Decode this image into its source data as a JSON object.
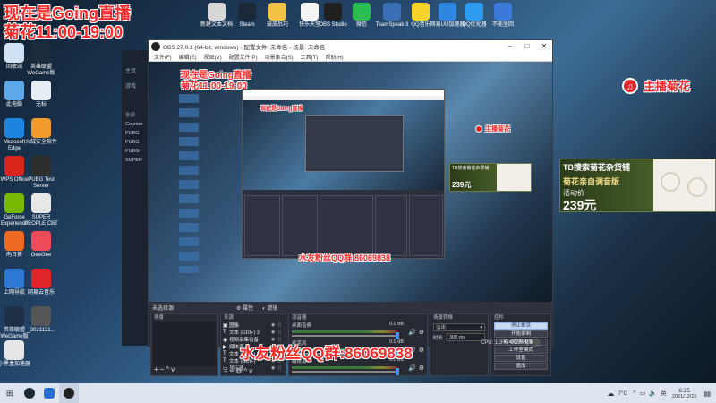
{
  "overlay": {
    "title_line1": "现在是Going直播",
    "title_line2": "菊花11:00-19:00",
    "host_label": "主播菊花",
    "fan_group": "水友粉丝QQ群:86069838"
  },
  "banner": {
    "line1": "TB搜索菊花杂货铺",
    "line2": "菊花亲自调音版",
    "line3": "活动价",
    "price": "239元"
  },
  "top_icons": [
    {
      "label": "新建文本文档",
      "color": "#d7d7d7"
    },
    {
      "label": "Steam",
      "color": "#1b2838"
    },
    {
      "label": "鼓皮后巧",
      "color": "#f2c244"
    },
    {
      "label": "快乐天堂",
      "color": "#f5f5f5"
    },
    {
      "label": "OBS Studio",
      "color": "#202020"
    },
    {
      "label": "微信",
      "color": "#2bbd52"
    },
    {
      "label": "TeamSpeak 3",
      "color": "#3a6fb5"
    },
    {
      "label": "QQ音乐",
      "color": "#f7d42c"
    },
    {
      "label": "网易UU加速器",
      "color": "#2f86e0"
    },
    {
      "label": "QQ优化器",
      "color": "#2d9cf0"
    },
    {
      "label": "不能坐回",
      "color": "#3b7ad8"
    }
  ],
  "desktop_icons": [
    {
      "label": "回收站",
      "color": "#cfe1f2"
    },
    {
      "label": "英雄联盟WeGame版",
      "color": "#1d2a3a"
    },
    {
      "label": "此电脑",
      "color": "#5da8e8"
    },
    {
      "label": "无标",
      "color": "#e8eef5"
    },
    {
      "label": "Microsoft Edge",
      "color": "#1d85e0"
    },
    {
      "label": "火绒安全软件",
      "color": "#f29a2e"
    },
    {
      "label": "WPS Office",
      "color": "#d8261c"
    },
    {
      "label": "PUBG Test Server",
      "color": "#2e2e2e"
    },
    {
      "label": "GeForce Experience",
      "color": "#76b900"
    },
    {
      "label": "SUPER PEOPLE CBT",
      "color": "#e8e8e8"
    },
    {
      "label": "向日葵",
      "color": "#ee6a21"
    },
    {
      "label": "GeeGee",
      "color": "#ee4b58"
    },
    {
      "label": "上网导航",
      "color": "#2d78d2"
    },
    {
      "label": "网易云音乐",
      "color": "#e1262a"
    },
    {
      "label": "英雄联盟WeGame版",
      "color": "#1f2f45"
    },
    {
      "label": "_2021121...",
      "color": "#555"
    },
    {
      "label": "小黑盒加速器",
      "color": "#e6e6e6"
    }
  ],
  "obs": {
    "title": "OBS 27.0.1 (64-bit, windows) - 配置文件: 未命名 - 场景: 未命名",
    "menu": [
      "文件(F)",
      "编辑(E)",
      "视图(V)",
      "配置文件(P)",
      "场景集合(S)",
      "工具(T)",
      "帮助(H)"
    ],
    "scenes_title": "场景",
    "scenes_header": "未选择源",
    "props_label": "属性",
    "filters_label": "滤镜",
    "sources_title": "来源",
    "sources": [
      {
        "name": "图像"
      },
      {
        "name": "文本 (GDI+) 3"
      },
      {
        "name": "视频采集设备"
      },
      {
        "name": "媒体源"
      },
      {
        "name": "文本 (GDI+) 2"
      },
      {
        "name": "文本 (GDI+)"
      },
      {
        "name": "显示器"
      }
    ],
    "mixer_title": "混音器",
    "mixer": [
      {
        "name": "桌面音频",
        "db": "0.0 dB"
      },
      {
        "name": "麦克风",
        "db": "0.0 dB"
      },
      {
        "name": "媒体源",
        "db": "0.0 dB"
      }
    ],
    "transitions_title": "场景转换",
    "transition_value": "淡出",
    "duration_label": "时长",
    "duration_value": "300 ms",
    "controls_title": "控件",
    "controls": [
      "停止推流",
      "开始录制",
      "启动虚拟摄像机",
      "工作室模式",
      "设置",
      "退出"
    ],
    "status": "CPU: 1.3%, 60.00 fps"
  },
  "left_panel": {
    "home": "主页",
    "games": "游戏",
    "all_label": "全部",
    "items": [
      "Counter",
      "PUBG",
      "PUBG",
      "PUBG",
      "SUPER"
    ]
  },
  "taskbar": {
    "time": "6:25",
    "date": "2021/12/15",
    "temp": "7°C",
    "ime": "英"
  }
}
